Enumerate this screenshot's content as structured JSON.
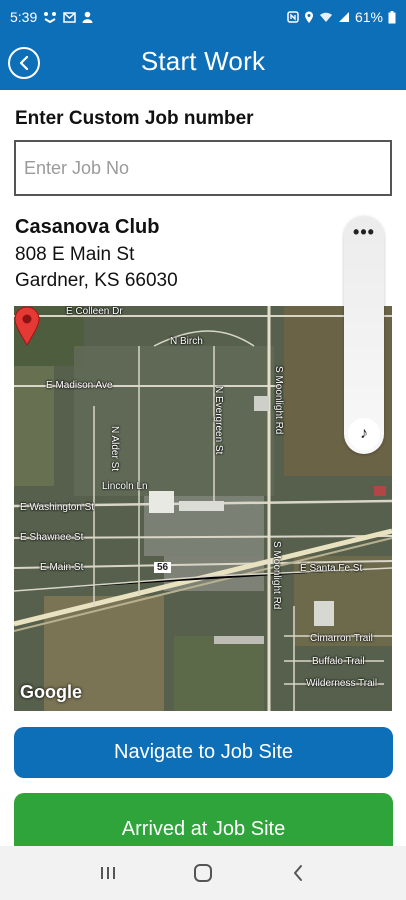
{
  "status_bar": {
    "time": "5:39",
    "battery": "61%",
    "icons": [
      "signal-icon",
      "mail-icon",
      "person-icon",
      "nfc-icon",
      "location-icon",
      "wifi-icon",
      "cell-icon",
      "battery-icon"
    ]
  },
  "header": {
    "title": "Start Work",
    "back_icon": "chevron-left-icon"
  },
  "form": {
    "label": "Enter Custom Job number",
    "placeholder": "Enter Job No",
    "value": ""
  },
  "site": {
    "name": "Casanova Club",
    "address_line1": "808 E Main St",
    "address_line2": "Gardner, KS 66030"
  },
  "map": {
    "streets": {
      "colleen": "E Colleen Dr",
      "birch": "N Birch",
      "madison": "E Madison Ave",
      "alder": "N Alder St",
      "evergreen": "N Evergreen St",
      "moonlight1": "S Moonlight Rd",
      "lincoln": "Lincoln Ln",
      "washington": "E Washington St",
      "shawnee": "E Shawnee St",
      "main": "E Main St",
      "route": "56",
      "santafe": "E Santa Fe St",
      "moonlight2": "S Moonlight Rd",
      "cimarron": "Cimarron Trail",
      "buffalo": "Buffalo Trail",
      "wilderness": "Wilderness Trail"
    },
    "attribution": "Google",
    "pin_color": "#e53935"
  },
  "side_panel": {
    "menu_icon": "more-horizontal-icon",
    "dots": "•••",
    "music_icon": "music-note-icon",
    "note_glyph": "♪"
  },
  "actions": {
    "navigate_label": "Navigate to Job Site",
    "arrived_label": "Arrived at Job Site"
  },
  "colors": {
    "primary": "#0d6fb8",
    "success": "#2fa43a"
  },
  "nav_bar": {
    "recent_icon": "recent-apps-icon",
    "home_icon": "home-icon",
    "back_icon": "back-icon"
  }
}
